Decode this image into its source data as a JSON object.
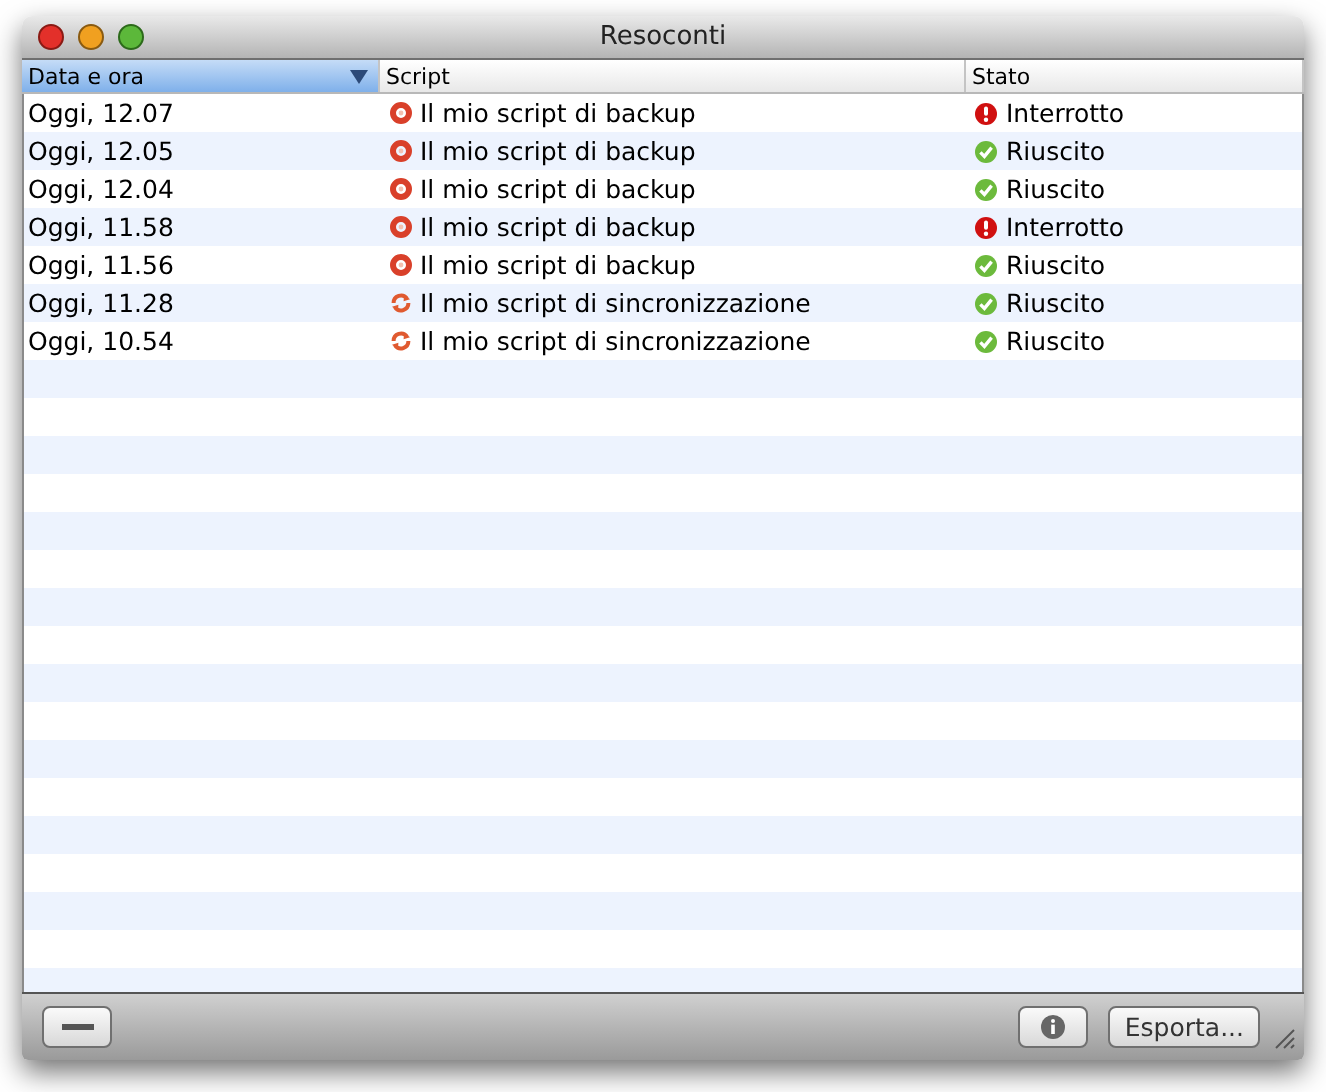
{
  "window": {
    "title": "Resoconti"
  },
  "table": {
    "columns": [
      {
        "label": "Data e ora",
        "selected": true
      },
      {
        "label": "Script",
        "selected": false
      },
      {
        "label": "Stato",
        "selected": false
      }
    ],
    "rows": [
      {
        "date": "Oggi, 12.07",
        "script": {
          "kind": "backup",
          "name": "Il mio script di backup"
        },
        "status": {
          "kind": "error",
          "label": "Interrotto"
        }
      },
      {
        "date": "Oggi, 12.05",
        "script": {
          "kind": "backup",
          "name": "Il mio script di backup"
        },
        "status": {
          "kind": "success",
          "label": "Riuscito"
        }
      },
      {
        "date": "Oggi, 12.04",
        "script": {
          "kind": "backup",
          "name": "Il mio script di backup"
        },
        "status": {
          "kind": "success",
          "label": "Riuscito"
        }
      },
      {
        "date": "Oggi, 11.58",
        "script": {
          "kind": "backup",
          "name": "Il mio script di backup"
        },
        "status": {
          "kind": "error",
          "label": "Interrotto"
        }
      },
      {
        "date": "Oggi, 11.56",
        "script": {
          "kind": "backup",
          "name": "Il mio script di backup"
        },
        "status": {
          "kind": "success",
          "label": "Riuscito"
        }
      },
      {
        "date": "Oggi, 11.28",
        "script": {
          "kind": "sync",
          "name": "Il mio script di sincronizzazione"
        },
        "status": {
          "kind": "success",
          "label": "Riuscito"
        }
      },
      {
        "date": "Oggi, 10.54",
        "script": {
          "kind": "sync",
          "name": "Il mio script di sincronizzazione"
        },
        "status": {
          "kind": "success",
          "label": "Riuscito"
        }
      }
    ]
  },
  "bottom_bar": {
    "export_button": "Esporta..."
  }
}
